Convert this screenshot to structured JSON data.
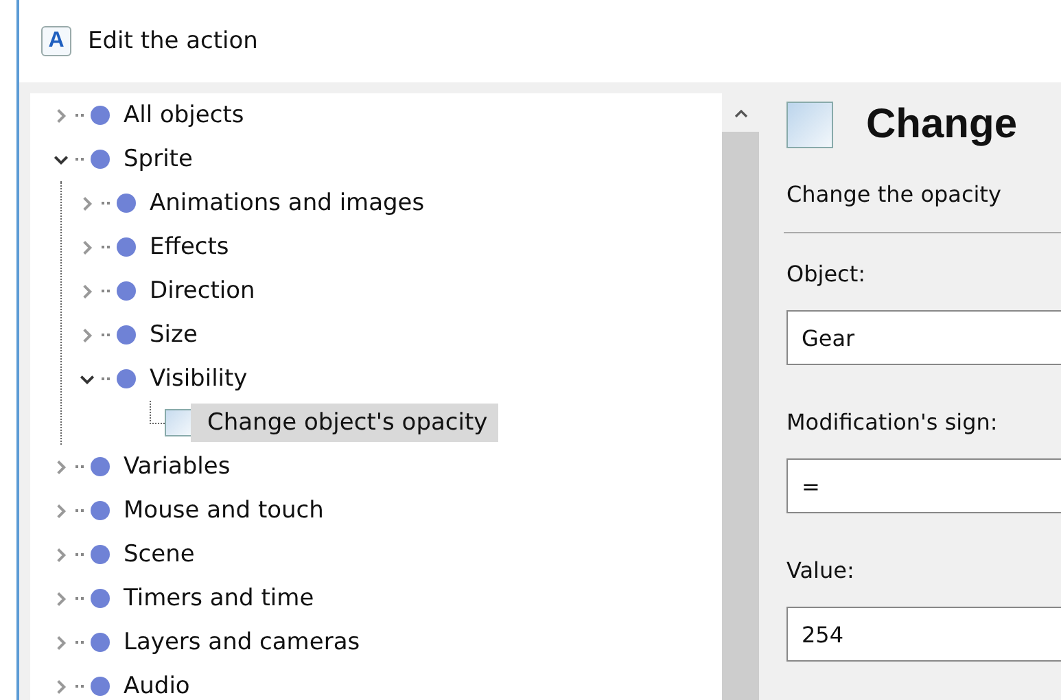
{
  "window": {
    "icon_letter": "A",
    "title": "Edit the action"
  },
  "tree": [
    {
      "kind": "category",
      "label": "All objects",
      "expanded": false,
      "selected": false
    },
    {
      "kind": "category",
      "label": "Sprite",
      "expanded": true,
      "selected": false,
      "children": [
        {
          "kind": "category",
          "label": "Animations and images",
          "expanded": false,
          "selected": false
        },
        {
          "kind": "category",
          "label": "Effects",
          "expanded": false,
          "selected": false
        },
        {
          "kind": "category",
          "label": "Direction",
          "expanded": false,
          "selected": false
        },
        {
          "kind": "category",
          "label": "Size",
          "expanded": false,
          "selected": false
        },
        {
          "kind": "category",
          "label": "Visibility",
          "expanded": true,
          "selected": false,
          "children": [
            {
              "kind": "action",
              "label": "Change object's opacity",
              "selected": true
            }
          ]
        }
      ]
    },
    {
      "kind": "category",
      "label": "Variables",
      "expanded": false,
      "selected": false
    },
    {
      "kind": "category",
      "label": "Mouse and touch",
      "expanded": false,
      "selected": false
    },
    {
      "kind": "category",
      "label": "Scene",
      "expanded": false,
      "selected": false
    },
    {
      "kind": "category",
      "label": "Timers and time",
      "expanded": false,
      "selected": false
    },
    {
      "kind": "category",
      "label": "Layers and cameras",
      "expanded": false,
      "selected": false
    },
    {
      "kind": "category",
      "label": "Audio",
      "expanded": false,
      "selected": false
    }
  ],
  "action": {
    "title": "Change",
    "description": "Change the opacity",
    "parameters": [
      {
        "label": "Object:",
        "value": "Gear"
      },
      {
        "label": "Modification's sign:",
        "value": "="
      },
      {
        "label": "Value:",
        "value": "254"
      }
    ]
  }
}
